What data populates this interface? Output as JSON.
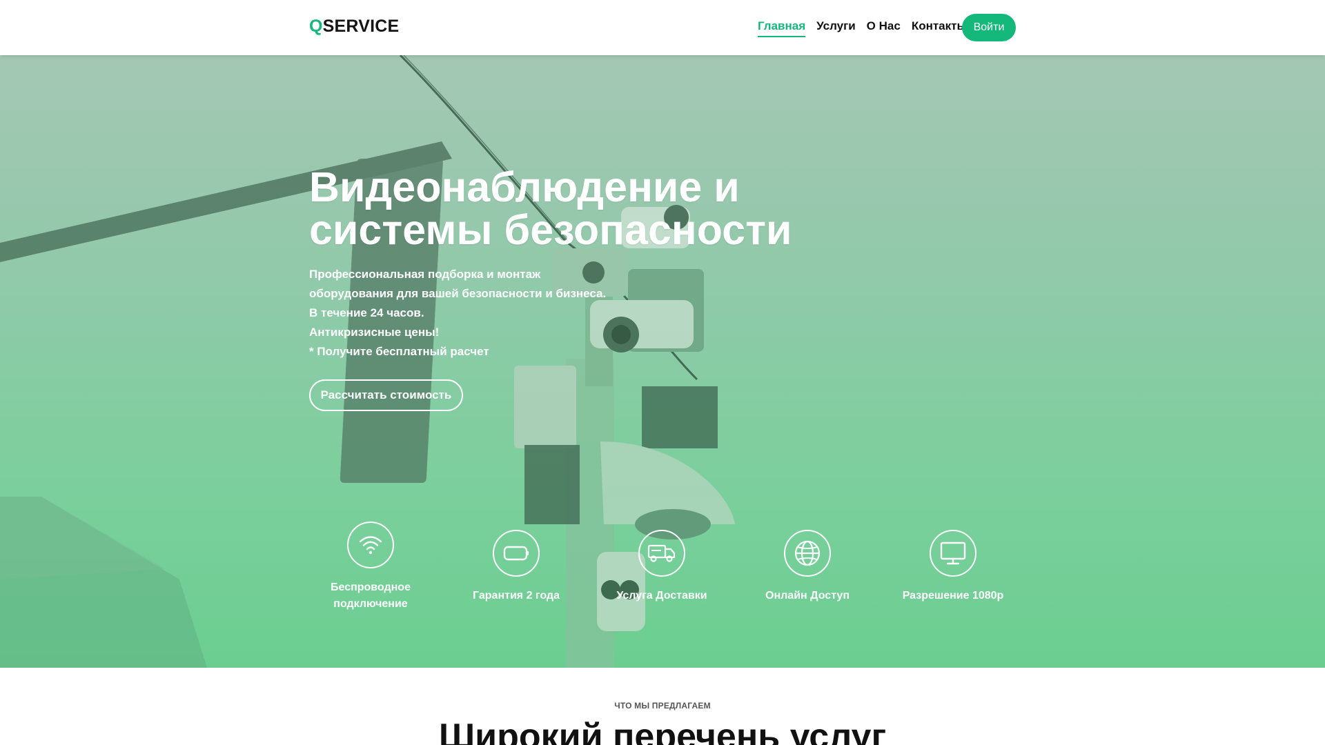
{
  "header": {
    "logo_q": "Q",
    "logo_rest": "SERVICE",
    "nav": [
      {
        "label": "Главная",
        "active": true
      },
      {
        "label": "Услуги",
        "active": false
      },
      {
        "label": "О Нас",
        "active": false
      },
      {
        "label": "Контакты",
        "active": false
      }
    ],
    "login_label": "Войти"
  },
  "hero": {
    "title": "Видеонаблюдение и системы безопасности",
    "lines": [
      "Профессиональная подборка и монтаж",
      "оборудования для вашей безопасности и бизнеса.",
      "В течение 24 часов.",
      "Антикризисные цены!",
      "* Получите бесплатный расчет"
    ],
    "cta_label": "Рассчитать стоимость",
    "features": [
      {
        "icon": "wifi-icon",
        "label": "Беспроводное подключение"
      },
      {
        "icon": "battery-icon",
        "label": "Гарантия 2 года"
      },
      {
        "icon": "truck-icon",
        "label": "Услуга Доставки"
      },
      {
        "icon": "globe-icon",
        "label": "Онлайн Доступ"
      },
      {
        "icon": "monitor-icon",
        "label": "Разрешение 1080p"
      }
    ]
  },
  "services": {
    "kicker": "ЧТО МЫ ПРЕДЛАГАЕМ",
    "title": "Широкий перечень услуг"
  },
  "colors": {
    "accent": "#14b87a",
    "hero_top": "#a9c7b7",
    "hero_bottom": "#6dcf92"
  }
}
